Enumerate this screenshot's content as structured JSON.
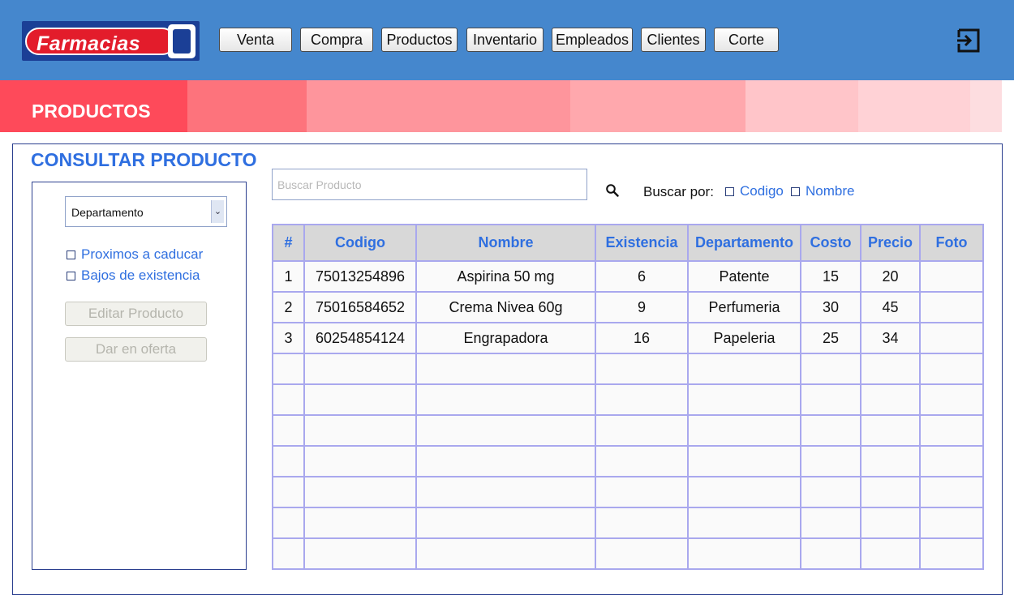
{
  "brand": {
    "logo_text": "Farmacias",
    "logo_mark": "GI"
  },
  "nav": {
    "items": [
      "Venta",
      "Compra",
      "Productos",
      "Inventario",
      "Empleados",
      "Clientes",
      "Corte"
    ],
    "logout_icon": "logout-icon"
  },
  "section": {
    "title": "PRODUCTOS",
    "band_colors": [
      "#fe4a5a",
      "#fd737c",
      "#fe959c",
      "#ffa8ad",
      "#ffc5c9",
      "#ffd2d6",
      "#fddde0"
    ]
  },
  "panel": {
    "title": "CONSULTAR PRODUCTO"
  },
  "filters": {
    "department_select": "Departamento",
    "checkboxes": [
      "Proximos a caducar",
      "Bajos de existencia"
    ],
    "edit_button": "Editar Producto",
    "offer_button": "Dar en oferta"
  },
  "search": {
    "placeholder": "Buscar Producto",
    "search_by_label": "Buscar por:",
    "options": [
      "Codigo",
      "Nombre"
    ]
  },
  "table": {
    "columns": [
      "#",
      "Codigo",
      "Nombre",
      "Existencia",
      "Departamento",
      "Costo",
      "Precio",
      "Foto"
    ],
    "rows": [
      [
        "1",
        "75013254896",
        "Aspirina 50 mg",
        "6",
        "Patente",
        "15",
        "20",
        ""
      ],
      [
        "2",
        "75016584652",
        "Crema Nivea 60g",
        "9",
        "Perfumeria",
        "30",
        "45",
        ""
      ],
      [
        "3",
        "60254854124",
        "Engrapadora",
        "16",
        "Papeleria",
        "25",
        "34",
        ""
      ],
      [
        "",
        "",
        "",
        "",
        "",
        "",
        "",
        ""
      ],
      [
        "",
        "",
        "",
        "",
        "",
        "",
        "",
        ""
      ],
      [
        "",
        "",
        "",
        "",
        "",
        "",
        "",
        ""
      ],
      [
        "",
        "",
        "",
        "",
        "",
        "",
        "",
        ""
      ],
      [
        "",
        "",
        "",
        "",
        "",
        "",
        "",
        ""
      ],
      [
        "",
        "",
        "",
        "",
        "",
        "",
        "",
        ""
      ],
      [
        "",
        "",
        "",
        "",
        "",
        "",
        "",
        ""
      ]
    ]
  },
  "colors": {
    "header": "#4587cd",
    "accent": "#2f6fe0",
    "table_border": "#a9a8ee",
    "table_header_bg": "#d8d8d8"
  }
}
